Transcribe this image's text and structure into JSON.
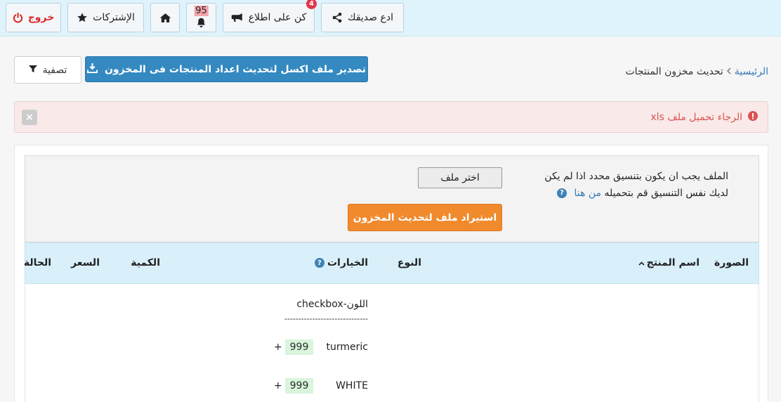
{
  "topbar": {
    "logout": "خروج",
    "subscriptions": "الإشتركات",
    "notifications_count": "95",
    "stay_informed": "كن على اطلاع",
    "stay_informed_badge": "4",
    "invite_friend": "ادع صديقك"
  },
  "breadcrumb": {
    "home": "الرئيسية",
    "current": "تحديث مخزون المنتجات"
  },
  "actions": {
    "export": "تصدير ملف اكسل لتحديث اعداد المنتجات فى المخزون",
    "filter": "تصفية"
  },
  "alert": {
    "message": "الرجاء تحميل ملف xls",
    "close": "×"
  },
  "upload": {
    "line1": "الملف يجب ان يكون بتنسيق محدد اذا لم يكن",
    "line2": "لديك نفس التنسيق قم بتحميله",
    "link": "من هنا",
    "help": "?",
    "choose_file": "اختر ملف",
    "import": "استيراد ملف لتحديث المخزون"
  },
  "table": {
    "headers": {
      "image": "الصورة",
      "product_name": "اسم المنتج",
      "sort_icon": "^",
      "type": "النوع",
      "options": "الخيارات",
      "options_help": "?",
      "quantity": "الكمية",
      "price": "السعر",
      "status": "الحالة"
    },
    "option_group": "اللون-checkbox",
    "divider": "------------------------------",
    "options": [
      {
        "name": "turmeric",
        "qty": "999",
        "plus": "+"
      },
      {
        "name": "WHITE",
        "qty": "999",
        "plus": "+"
      }
    ]
  },
  "colors": {
    "topbar": "#dff3fc",
    "primary": "#3489c1",
    "accent": "#f08a2c",
    "danger": "#e2364a",
    "alert_bg": "#f9e9e9"
  }
}
